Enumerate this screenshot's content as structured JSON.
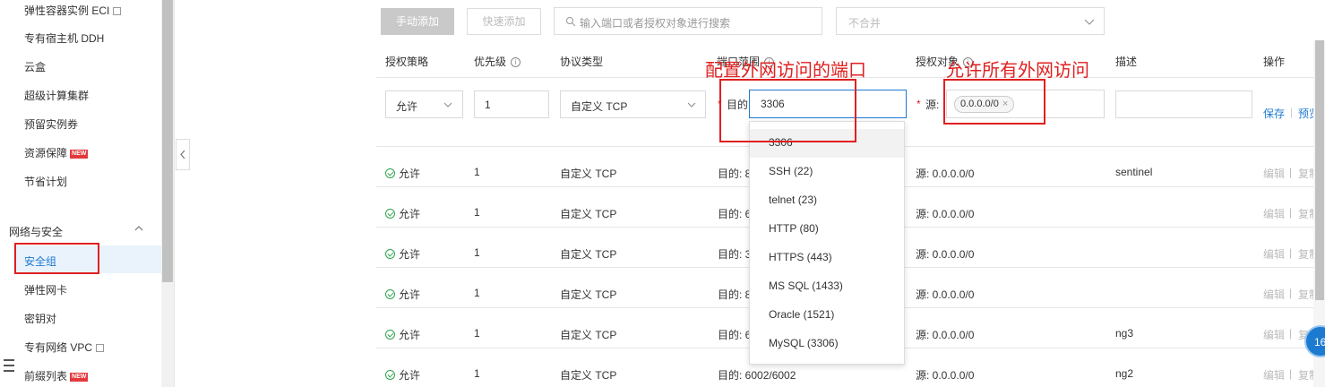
{
  "sidebar": {
    "items": [
      {
        "label": "弹性容器实例 ECI",
        "external": true
      },
      {
        "label": "专有宿主机 DDH"
      },
      {
        "label": "云盒"
      },
      {
        "label": "超级计算集群"
      },
      {
        "label": "预留实例券"
      },
      {
        "label": "资源保障",
        "badge": "NEW"
      },
      {
        "label": "节省计划"
      }
    ],
    "section_title": "网络与安全",
    "section_items": [
      {
        "label": "安全组",
        "active": true
      },
      {
        "label": "弹性网卡"
      },
      {
        "label": "密钥对"
      },
      {
        "label": "专有网络 VPC",
        "external": true
      },
      {
        "label": "前缀列表",
        "badge": "NEW"
      }
    ]
  },
  "toolbar": {
    "manual_add": "手动添加",
    "quick_add": "快速添加",
    "search_placeholder": "输入端口或者授权对象进行搜索",
    "merge_select": "不合并"
  },
  "table": {
    "headers": {
      "policy": "授权策略",
      "priority": "优先级",
      "protocol": "协议类型",
      "port_range": "端口范围",
      "auth_object": "授权对象",
      "description": "描述",
      "actions": "操作"
    },
    "edit_row": {
      "policy": "允许",
      "priority": "1",
      "protocol": "自定义 TCP",
      "port_prefix": "目的",
      "port_value": "3306",
      "source_prefix": "源",
      "source_tag": "0.0.0.0/0",
      "save": "保存",
      "preview": "预览"
    },
    "rows": [
      {
        "policy": "允许",
        "priority": "1",
        "protocol": "自定义 TCP",
        "port": "目的: 8",
        "source": "源: 0.0.0.0/0",
        "desc": "sentinel"
      },
      {
        "policy": "允许",
        "priority": "1",
        "protocol": "自定义 TCP",
        "port": "目的: 6",
        "source": "源: 0.0.0.0/0",
        "desc": ""
      },
      {
        "policy": "允许",
        "priority": "1",
        "protocol": "自定义 TCP",
        "port": "目的: 3",
        "source": "源: 0.0.0.0/0",
        "desc": ""
      },
      {
        "policy": "允许",
        "priority": "1",
        "protocol": "自定义 TCP",
        "port": "目的: 8",
        "source": "源: 0.0.0.0/0",
        "desc": ""
      },
      {
        "policy": "允许",
        "priority": "1",
        "protocol": "自定义 TCP",
        "port": "目的: 6",
        "source": "源: 0.0.0.0/0",
        "desc": "ng3"
      },
      {
        "policy": "允许",
        "priority": "1",
        "protocol": "自定义 TCP",
        "port": "目的: 6002/6002",
        "source": "源: 0.0.0.0/0",
        "desc": "ng2"
      }
    ],
    "row_actions": {
      "edit": "编辑",
      "sep": "|",
      "copy": "复制",
      "sep2": "|"
    }
  },
  "dropdown": {
    "options": [
      "3306",
      "SSH (22)",
      "telnet (23)",
      "HTTP (80)",
      "HTTPS (443)",
      "MS SQL (1433)",
      "Oracle (1521)",
      "MySQL (3306)"
    ]
  },
  "annotations": {
    "port_note": "配置外网访问的端口",
    "source_note": "允许所有外网访问"
  },
  "help_bubble": "16",
  "colors": {
    "accent": "#1d7ad1",
    "annotation": "#e02020",
    "success": "#2fa44f"
  }
}
